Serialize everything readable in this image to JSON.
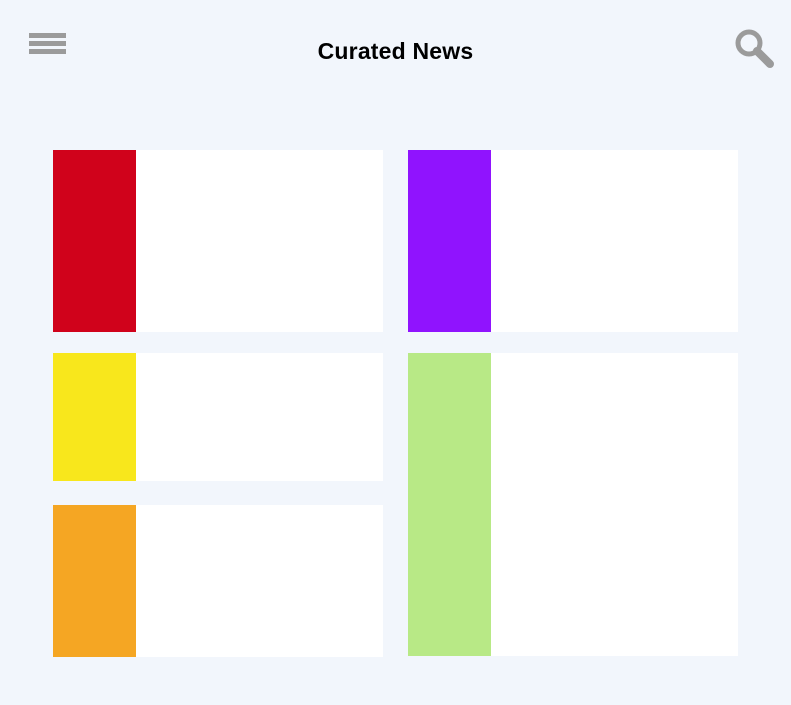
{
  "header": {
    "title": "Curated News",
    "menu_icon": "hamburger-menu-icon",
    "search_icon": "search-icon",
    "icon_color": "#9b9b9b"
  },
  "background_color": "#f2f6fc",
  "cards": [
    {
      "accent": "#d0021b"
    },
    {
      "accent": "#9013fe"
    },
    {
      "accent": "#f8e71c"
    },
    {
      "accent": "#b8e986"
    },
    {
      "accent": "#f5a623"
    }
  ]
}
